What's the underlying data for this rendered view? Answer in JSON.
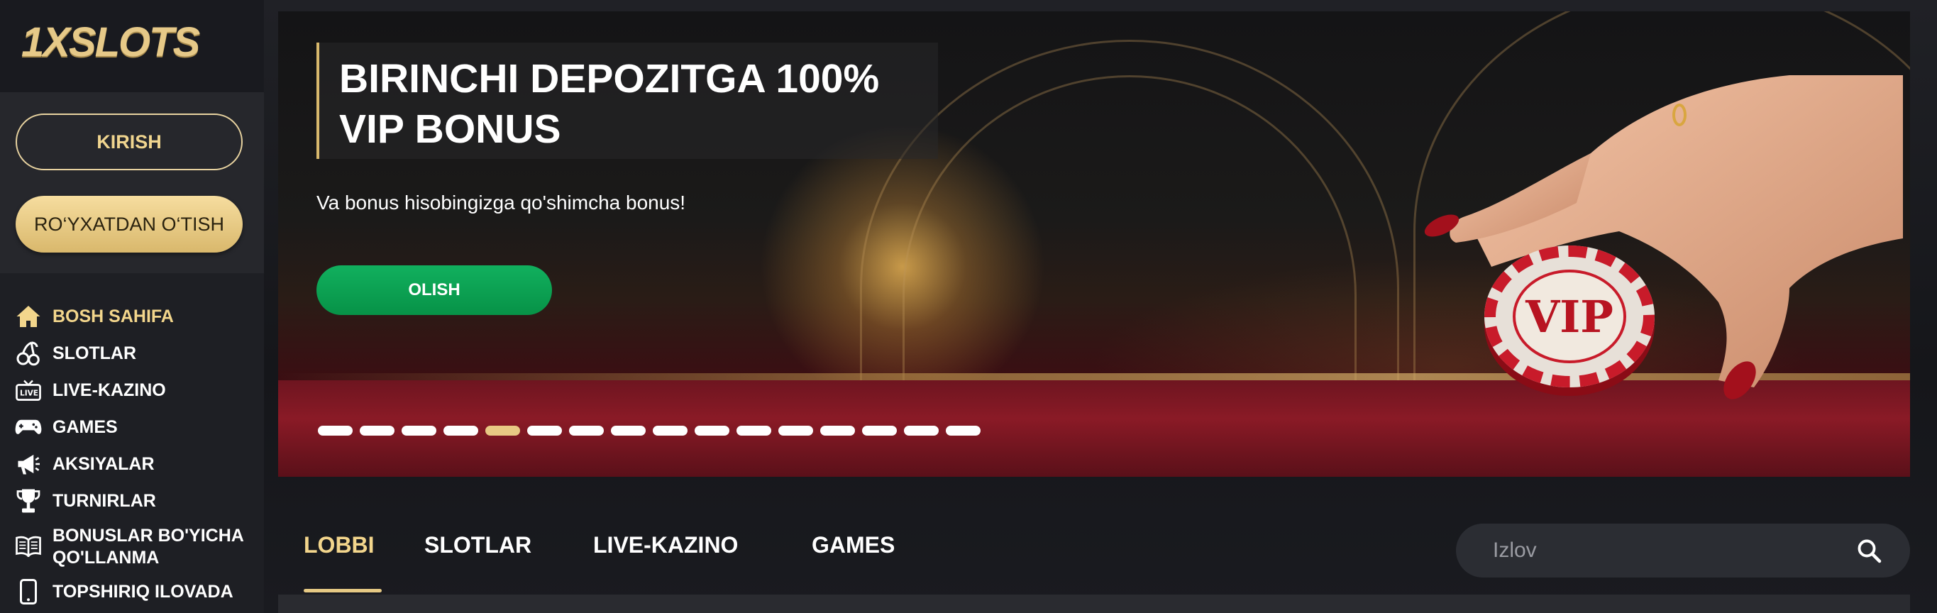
{
  "brand": {
    "logo_text": "1XSLOTS"
  },
  "auth": {
    "login_label": "KIRISH",
    "register_label": "RO‘YXATDAN O‘TISH"
  },
  "nav": {
    "items": [
      {
        "label": "BOSH SAHIFA",
        "icon": "home-icon",
        "active": true
      },
      {
        "label": "SLOTLAR",
        "icon": "cherries-icon",
        "active": false
      },
      {
        "label": "LIVE-KAZINO",
        "icon": "live-tv-icon",
        "active": false
      },
      {
        "label": "GAMES",
        "icon": "gamepad-icon",
        "active": false
      },
      {
        "label": "AKSIYALAR",
        "icon": "megaphone-icon",
        "active": false
      },
      {
        "label": "TURNIRLAR",
        "icon": "trophy-icon",
        "active": false
      },
      {
        "label": "BONUSLAR BO'YICHA QO'LLANMA",
        "icon": "book-icon",
        "active": false
      },
      {
        "label": "TOPSHIRIQ ILOVADA",
        "icon": "phone-icon",
        "active": false
      }
    ]
  },
  "hero": {
    "title": "BIRINCHI DEPOZITGA 100%\nVIP BONUS",
    "subtitle": "Va bonus hisobingizga qo'shimcha bonus!",
    "cta_label": "OLISH",
    "chip_text": "VIP",
    "slides_total": 16,
    "active_slide": 5
  },
  "tabs": [
    {
      "label": "LOBBI",
      "active": true
    },
    {
      "label": "SLOTLAR",
      "active": false
    },
    {
      "label": "LIVE-KAZINO",
      "active": false
    },
    {
      "label": "GAMES",
      "active": false
    }
  ],
  "search": {
    "placeholder": "Izlov",
    "value": ""
  },
  "colors": {
    "accent_gold": "#f3d68c",
    "cta_green": "#0aa352",
    "sidebar_bg": "#1e1f24",
    "page_bg": "#17181d"
  }
}
